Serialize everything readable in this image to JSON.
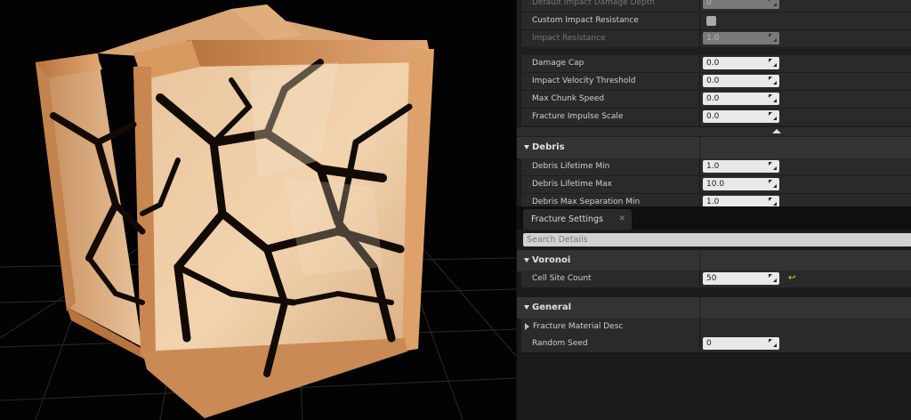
{
  "upper_section": {
    "rows_top": [
      {
        "label": "Default Impact Damage Depth",
        "value": "0",
        "disabled": true
      },
      {
        "label": "Custom Impact Resistance",
        "type": "checkbox",
        "checked": false
      },
      {
        "label": "Impact Resistance",
        "value": "1.0",
        "disabled": true
      }
    ],
    "rows_mid": [
      {
        "label": "Damage Cap",
        "value": "0.0"
      },
      {
        "label": "Impact Velocity Threshold",
        "value": "0.0"
      },
      {
        "label": "Max Chunk Speed",
        "value": "0.0"
      },
      {
        "label": "Fracture Impulse Scale",
        "value": "0.0"
      }
    ],
    "debris": {
      "title": "Debris",
      "rows": [
        {
          "label": "Debris Lifetime Min",
          "value": "1.0"
        },
        {
          "label": "Debris Lifetime Max",
          "value": "10.0"
        },
        {
          "label": "Debris Max Separation Min",
          "value": "1.0"
        }
      ]
    }
  },
  "tab": {
    "label": "Fracture Settings",
    "close": "✕"
  },
  "search": {
    "placeholder": "Search Details"
  },
  "voronoi": {
    "title": "Voronoi",
    "cell_site_count_label": "Cell Site Count",
    "cell_site_count_value": "50",
    "reset_icon": "reset-arrow-icon"
  },
  "general": {
    "title": "General",
    "fracture_material_desc": "Fracture Material Desc",
    "random_seed_label": "Random Seed",
    "random_seed_value": "0"
  },
  "colors": {
    "panel_bg": "#1b1b1b",
    "row_bg": "#2a2a2a",
    "category_bg": "#333333",
    "field_bg": "#e9e9e9",
    "reset_yellow": "#e6d12a",
    "cube_light": "#f2d2ad",
    "cube_frame": "#d89a62"
  }
}
